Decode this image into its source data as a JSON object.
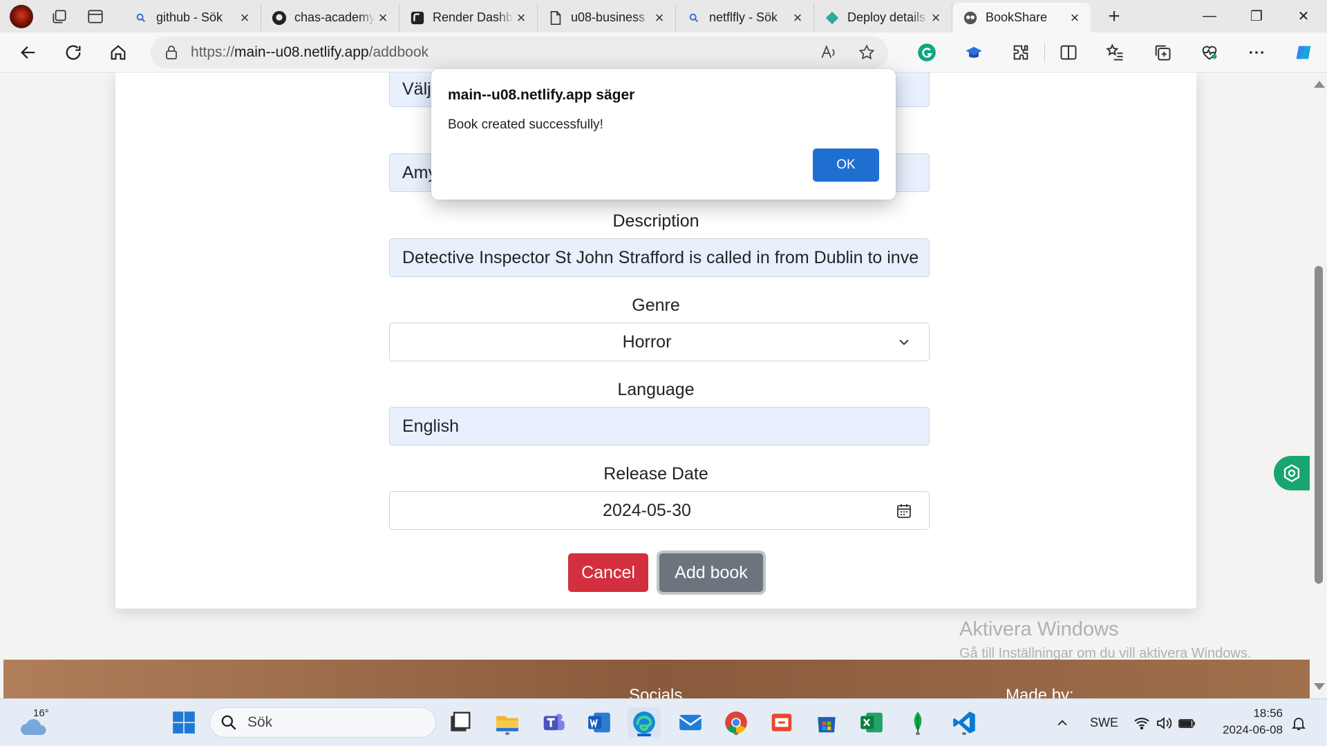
{
  "browser": {
    "tabs": [
      {
        "title": "github - Sök",
        "icon": "search-icon"
      },
      {
        "title": "chas-academy",
        "icon": "github-icon"
      },
      {
        "title": "Render Dashboard",
        "icon": "render-icon"
      },
      {
        "title": "u08-business",
        "icon": "document-icon"
      },
      {
        "title": "netflfly - Sök",
        "icon": "search-icon"
      },
      {
        "title": "Deploy details",
        "icon": "netlify-icon"
      },
      {
        "title": "BookShare",
        "icon": "bookshare-icon"
      }
    ],
    "active_tab_index": 6,
    "url_prefix": "https://",
    "url_host": "main--u08.netlify.app",
    "url_path": "/addbook"
  },
  "form": {
    "top_field_partial": "Välj",
    "author_partial": "Amy",
    "description_label": "Description",
    "description_value": "Detective Inspector St John Strafford is called in from Dublin to inve",
    "genre_label": "Genre",
    "genre_value": "Horror",
    "language_label": "Language",
    "language_value": "English",
    "release_label": "Release Date",
    "release_value": "2024-05-30",
    "cancel_label": "Cancel",
    "add_label": "Add book"
  },
  "footer": {
    "socials_partial": "Socials",
    "made_by_partial": "Made by:"
  },
  "watermark": {
    "title": "Aktivera Windows",
    "subtitle": "Gå till Inställningar om du vill aktivera Windows."
  },
  "dialog": {
    "title": "main--u08.netlify.app säger",
    "message": "Book created successfully!",
    "ok_label": "OK"
  },
  "taskbar": {
    "temperature": "16°",
    "search_placeholder": "Sök",
    "language": "SWE",
    "time": "18:56",
    "date": "2024-06-08"
  },
  "colors": {
    "accent": "#1f6fd1",
    "cancel": "#d32f3f",
    "add": "#6c757d",
    "filled_field": "#e8f0fe",
    "footer": "#8a5a3c"
  }
}
